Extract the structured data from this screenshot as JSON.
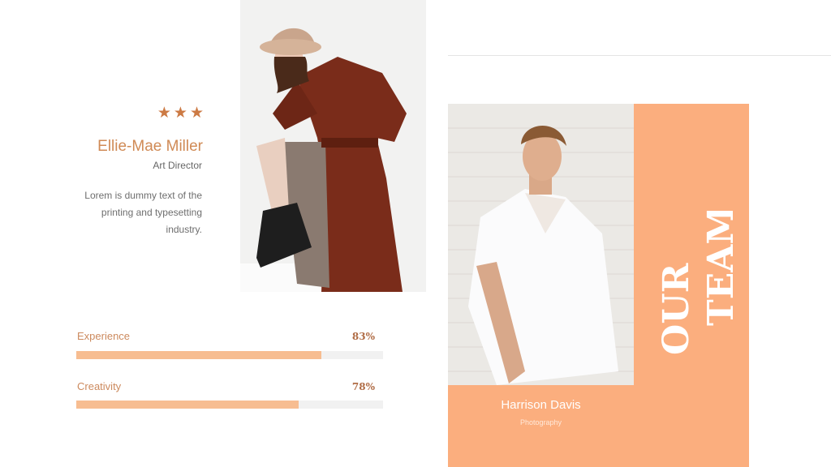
{
  "profile": {
    "stars": "★★★",
    "name": "Ellie-Mae Miller",
    "role": "Art Director",
    "description_lines": [
      "Lorem is dummy text of the",
      "printing and typesetting",
      "industry."
    ]
  },
  "skills": [
    {
      "label": "Experience",
      "value_text": "83%",
      "fraction": 0.8
    },
    {
      "label": "Creativity",
      "value_text": "78%",
      "fraction": 0.725
    }
  ],
  "team": {
    "heading_line1": "OUR",
    "heading_line2": "TEAM",
    "member_name": "Harrison Davis",
    "member_role": "Photography"
  },
  "colors": {
    "accent": "#fbae7e",
    "bar_fill": "#f7bd91",
    "name_text": "#d08a55"
  }
}
